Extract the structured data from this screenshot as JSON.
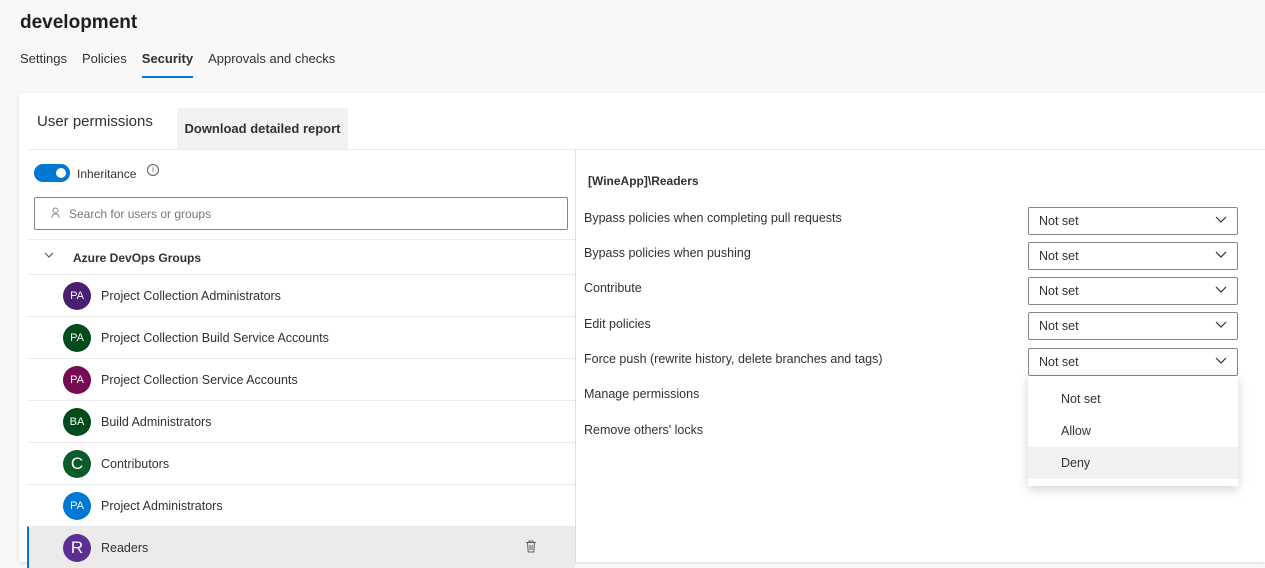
{
  "page": {
    "title": "development"
  },
  "tabs": [
    {
      "label": "Settings",
      "active": false
    },
    {
      "label": "Policies",
      "active": false
    },
    {
      "label": "Security",
      "active": true
    },
    {
      "label": "Approvals and checks",
      "active": false
    }
  ],
  "card": {
    "title": "User permissions",
    "download_label": "Download detailed report"
  },
  "left": {
    "inheritance_label": "Inheritance",
    "inheritance_on": true,
    "search_placeholder": "Search for users or groups",
    "search_value": "",
    "group_header": "Azure DevOps Groups",
    "groups": [
      {
        "initials": "PA",
        "label": "Project Collection Administrators",
        "color": "#4b1f6f"
      },
      {
        "initials": "PA",
        "label": "Project Collection Build Service Accounts",
        "color": "#004b1c"
      },
      {
        "initials": "PA",
        "label": "Project Collection Service Accounts",
        "color": "#750b52"
      },
      {
        "initials": "BA",
        "label": "Build Administrators",
        "color": "#004b1c"
      },
      {
        "initials": "C",
        "label": "Contributors",
        "color": "#0b5a29"
      },
      {
        "initials": "PA",
        "label": "Project Administrators",
        "color": "#0078d4"
      },
      {
        "initials": "R",
        "label": "Readers",
        "color": "#5c2e91",
        "selected": true
      }
    ]
  },
  "right": {
    "title": "[WineApp]\\Readers",
    "permissions": [
      {
        "label": "Bypass policies when completing pull requests",
        "value": "Not set"
      },
      {
        "label": "Bypass policies when pushing",
        "value": "Not set"
      },
      {
        "label": "Contribute",
        "value": "Not set"
      },
      {
        "label": "Edit policies",
        "value": "Not set"
      },
      {
        "label": "Force push (rewrite history, delete branches and tags)",
        "value": "Not set"
      },
      {
        "label": "Manage permissions",
        "value": ""
      },
      {
        "label": "Remove others' locks",
        "value": ""
      }
    ],
    "dropdown_options": [
      "Not set",
      "Allow",
      "Deny"
    ],
    "dropdown_hover": "Deny"
  },
  "colors": {
    "accent": "#0078d4"
  },
  "icons": [
    "info-icon",
    "search-icon",
    "chevron-down-icon",
    "trash-icon"
  ]
}
